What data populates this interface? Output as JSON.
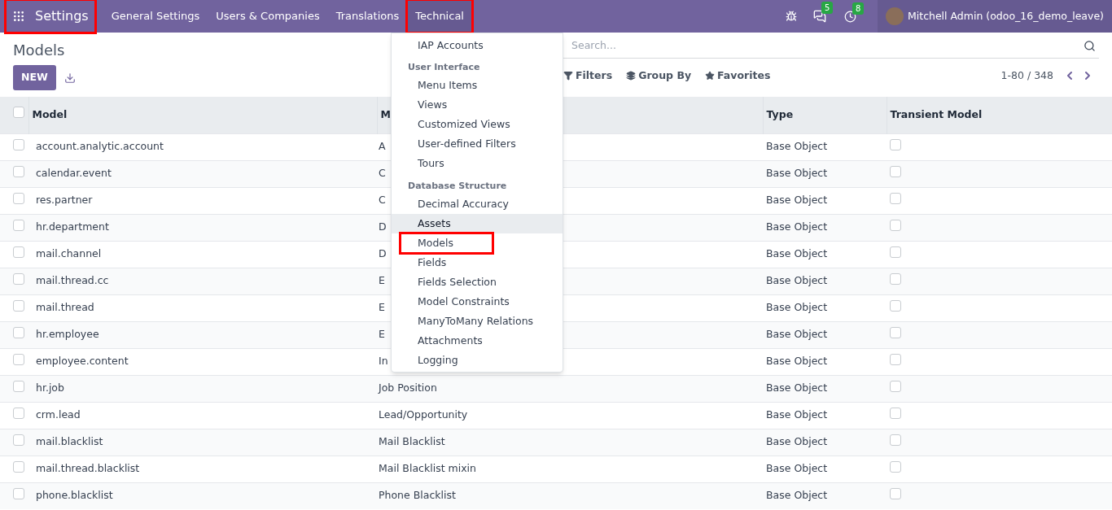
{
  "navbar": {
    "app": {
      "label": "Settings",
      "highlighted": true
    },
    "menus": [
      {
        "label": "General Settings",
        "selected": false,
        "highlighted": false
      },
      {
        "label": "Users & Companies",
        "selected": false,
        "highlighted": false
      },
      {
        "label": "Translations",
        "selected": false,
        "highlighted": false
      },
      {
        "label": "Technical",
        "selected": true,
        "highlighted": true
      }
    ],
    "messages_badge": "5",
    "activities_badge": "8",
    "user": "Mitchell Admin (odoo_16_demo_leave)"
  },
  "title": "Models",
  "new_button": "NEW",
  "search": {
    "placeholder": "Search..."
  },
  "filters": [
    "Filters",
    "Group By",
    "Favorites"
  ],
  "pager": "1-80 / 348",
  "table": {
    "all_selected": false,
    "columns": [
      "Model",
      "M",
      "Type",
      "Transient Model"
    ],
    "rows": [
      {
        "model": "account.analytic.account",
        "selected": false,
        "description": "A",
        "type": "Base Object",
        "transient": false
      },
      {
        "model": "calendar.event",
        "selected": false,
        "description": "C",
        "type": "Base Object",
        "transient": false
      },
      {
        "model": "res.partner",
        "selected": false,
        "description": "C",
        "type": "Base Object",
        "transient": false
      },
      {
        "model": "hr.department",
        "selected": false,
        "description": "D",
        "type": "Base Object",
        "transient": false
      },
      {
        "model": "mail.channel",
        "selected": false,
        "description": "D",
        "type": "Base Object",
        "transient": false
      },
      {
        "model": "mail.thread.cc",
        "selected": false,
        "description": "E",
        "type": "Base Object",
        "transient": false
      },
      {
        "model": "mail.thread",
        "selected": false,
        "description": "E",
        "type": "Base Object",
        "transient": false
      },
      {
        "model": "hr.employee",
        "selected": false,
        "description": "E",
        "type": "Base Object",
        "transient": false
      },
      {
        "model": "employee.content",
        "selected": false,
        "description": "In",
        "type": "Base Object",
        "transient": false
      },
      {
        "model": "hr.job",
        "selected": false,
        "description": "Job Position",
        "type": "Base Object",
        "transient": false
      },
      {
        "model": "crm.lead",
        "selected": false,
        "description": "Lead/Opportunity",
        "type": "Base Object",
        "transient": false
      },
      {
        "model": "mail.blacklist",
        "selected": false,
        "description": "Mail Blacklist",
        "type": "Base Object",
        "transient": false
      },
      {
        "model": "mail.thread.blacklist",
        "selected": false,
        "description": "Mail Blacklist mixin",
        "type": "Base Object",
        "transient": false
      },
      {
        "model": "phone.blacklist",
        "selected": false,
        "description": "Phone Blacklist",
        "type": "Base Object",
        "transient": false
      }
    ]
  },
  "dropdown": {
    "items": [
      {
        "kind": "item",
        "label": "IAP Accounts",
        "hovered": false,
        "highlighted": false
      },
      {
        "kind": "header",
        "label": "User Interface"
      },
      {
        "kind": "item",
        "label": "Menu Items",
        "hovered": false,
        "highlighted": false
      },
      {
        "kind": "item",
        "label": "Views",
        "hovered": false,
        "highlighted": false
      },
      {
        "kind": "item",
        "label": "Customized Views",
        "hovered": false,
        "highlighted": false
      },
      {
        "kind": "item",
        "label": "User-defined Filters",
        "hovered": false,
        "highlighted": false
      },
      {
        "kind": "item",
        "label": "Tours",
        "hovered": false,
        "highlighted": false
      },
      {
        "kind": "header",
        "label": "Database Structure"
      },
      {
        "kind": "item",
        "label": "Decimal Accuracy",
        "hovered": false,
        "highlighted": false
      },
      {
        "kind": "item",
        "label": "Assets",
        "hovered": true,
        "highlighted": false
      },
      {
        "kind": "item",
        "label": "Models",
        "hovered": false,
        "highlighted": true
      },
      {
        "kind": "item",
        "label": "Fields",
        "hovered": false,
        "highlighted": false
      },
      {
        "kind": "item",
        "label": "Fields Selection",
        "hovered": false,
        "highlighted": false
      },
      {
        "kind": "item",
        "label": "Model Constraints",
        "hovered": false,
        "highlighted": false
      },
      {
        "kind": "item",
        "label": "ManyToMany Relations",
        "hovered": false,
        "highlighted": false
      },
      {
        "kind": "item",
        "label": "Attachments",
        "hovered": false,
        "highlighted": false
      },
      {
        "kind": "item",
        "label": "Logging",
        "hovered": false,
        "highlighted": false
      }
    ]
  }
}
